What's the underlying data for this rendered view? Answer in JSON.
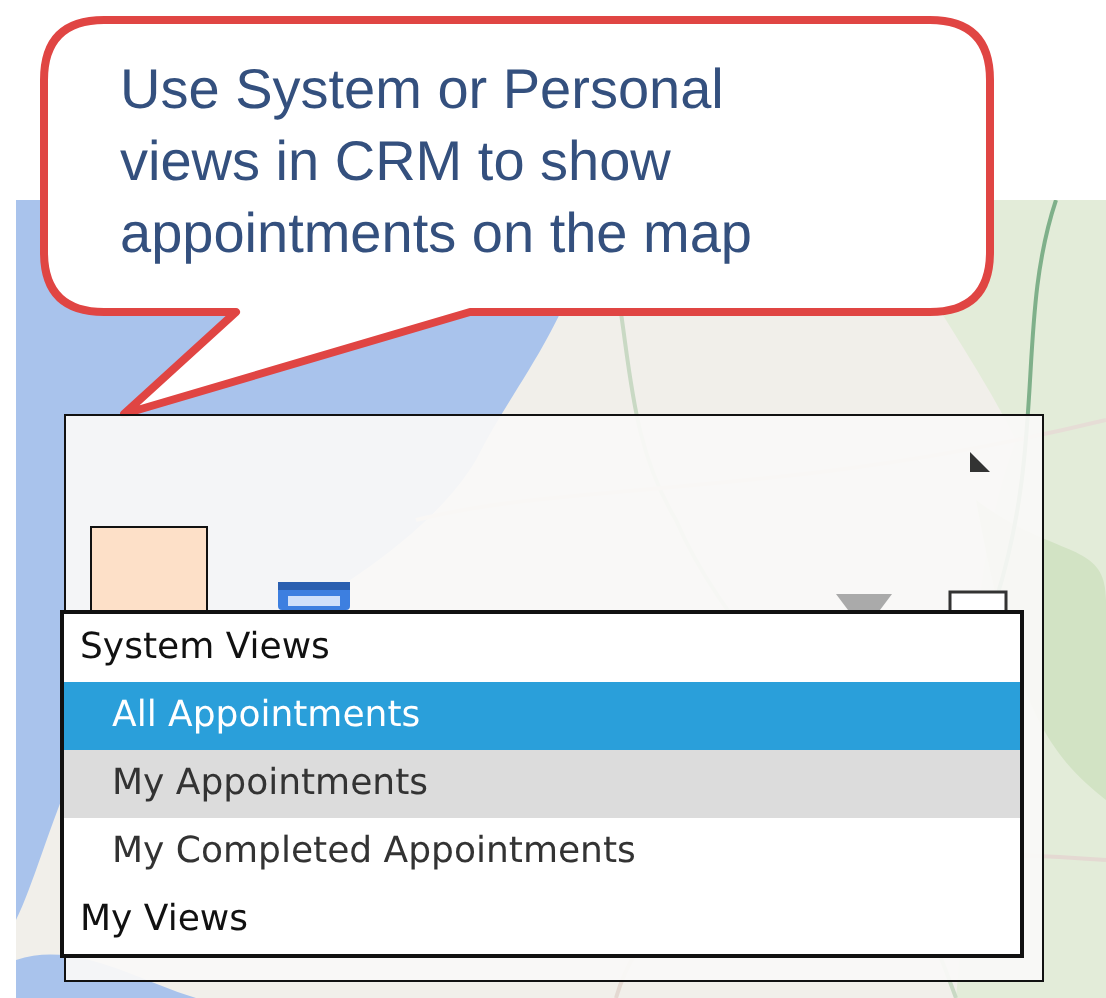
{
  "callout": {
    "text": "Use System or Personal views in CRM to show appointments on the map"
  },
  "view_menu": {
    "items": [
      {
        "kind": "header",
        "label": "System Views",
        "selected": false,
        "highlighted": false
      },
      {
        "kind": "view",
        "label": "All Appointments",
        "selected": true,
        "highlighted": false
      },
      {
        "kind": "view",
        "label": "My Appointments",
        "selected": false,
        "highlighted": true
      },
      {
        "kind": "view",
        "label": "My Completed Appointments",
        "selected": false,
        "highlighted": false
      },
      {
        "kind": "header",
        "label": "My Views",
        "selected": false,
        "highlighted": false
      }
    ]
  }
}
